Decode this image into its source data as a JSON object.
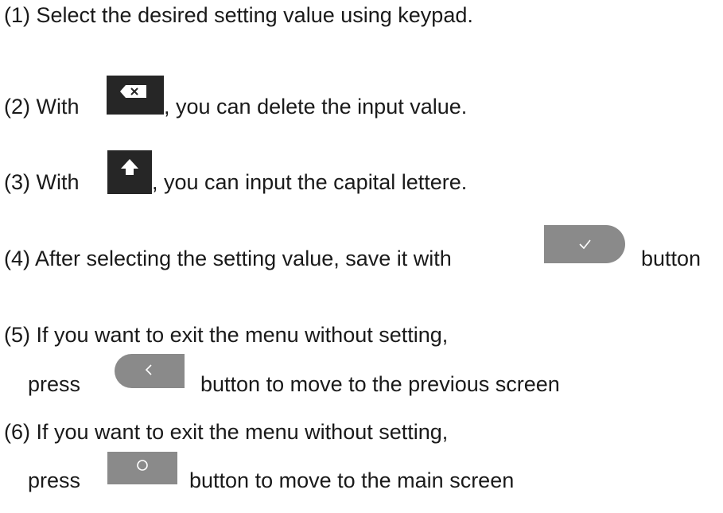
{
  "steps": [
    {
      "text": "(1) Select the desired setting value using keypad."
    },
    {
      "before": "(2) With ",
      "after": ", you can delete the input value."
    },
    {
      "before": "(3) With ",
      "after": ", you can input the capital lettere."
    },
    {
      "before": "(4) After selecting the setting value, save it with ",
      "after": "button"
    },
    {
      "line1": "(5) If you want to exit the menu without setting,",
      "before": "press ",
      "after": "button to move to the previous screen"
    },
    {
      "line1": "(6) If you want to exit the menu without setting,",
      "before": "press ",
      "after": "button to move to the main screen"
    }
  ],
  "icons": {
    "backspace": "backspace-icon",
    "shift": "shift-up-arrow-icon",
    "check": "checkmark-icon",
    "back": "chevron-left-icon",
    "home": "circle-home-icon"
  },
  "colors": {
    "dark_key": "#262626",
    "gray_button": "#8a8a8a",
    "text": "#1a1a1a"
  }
}
